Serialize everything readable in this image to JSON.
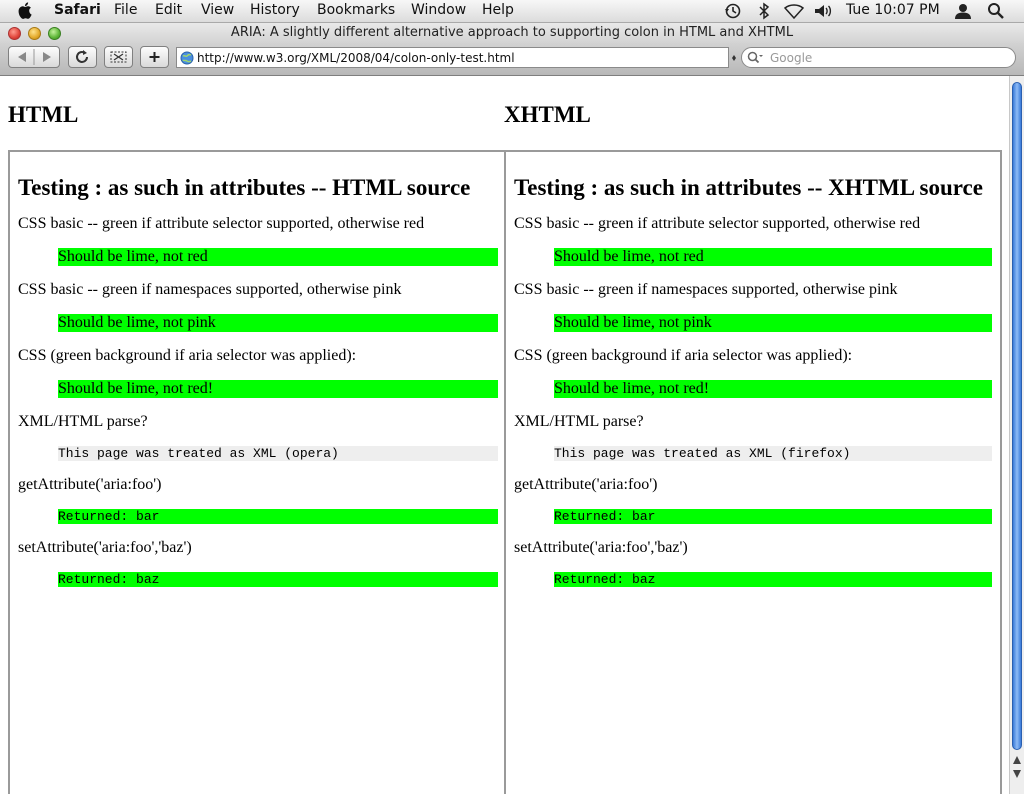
{
  "menubar": {
    "app": "Safari",
    "items": [
      "File",
      "Edit",
      "View",
      "History",
      "Bookmarks",
      "Window",
      "Help"
    ],
    "clock": "Tue 10:07 PM"
  },
  "window": {
    "title": "ARIA: A slightly different alternative approach to supporting colon in HTML and XHTML"
  },
  "toolbar": {
    "url": "http://www.w3.org/XML/2008/04/colon-only-test.html",
    "search_placeholder": "Google"
  },
  "page": {
    "left_heading": "HTML",
    "right_heading": "XHTML",
    "left": {
      "title": "Testing : as such in attributes -- HTML source",
      "css_basic_label": "CSS basic -- green if attribute selector supported, otherwise red",
      "css_basic_result": "Should be lime, not red",
      "ns_label": "CSS basic -- green if namespaces supported, otherwise pink",
      "ns_result": "Should be lime, not pink",
      "aria_label": "CSS (green background if aria selector was applied):",
      "aria_result": "Should be lime, not red!",
      "parse_label": "XML/HTML parse?",
      "parse_result": "This page was treated as XML (opera)",
      "get_label": "getAttribute('aria:foo')",
      "get_result": "Returned: bar",
      "set_label": "setAttribute('aria:foo','baz')",
      "set_result": "Returned: baz"
    },
    "right": {
      "title": "Testing : as such in attributes -- XHTML source",
      "css_basic_label": "CSS basic -- green if attribute selector supported, otherwise red",
      "css_basic_result": "Should be lime, not red",
      "ns_label": "CSS basic -- green if namespaces supported, otherwise pink",
      "ns_result": "Should be lime, not pink",
      "aria_label": "CSS (green background if aria selector was applied):",
      "aria_result": "Should be lime, not red!",
      "parse_label": "XML/HTML parse?",
      "parse_result": "This page was treated as XML (firefox)",
      "get_label": "getAttribute('aria:foo')",
      "get_result": "Returned: bar",
      "set_label": "setAttribute('aria:foo','baz')",
      "set_result": "Returned: baz"
    }
  },
  "colors": {
    "lime": "#00ff00",
    "code_bg": "#eeeeee",
    "scroll_thumb": "#5b98e8"
  },
  "icons": [
    "apple-icon",
    "time-machine-icon",
    "bluetooth-icon",
    "wifi-icon",
    "volume-icon",
    "user-icon",
    "spotlight-icon",
    "back-icon",
    "forward-icon",
    "reload-icon",
    "snippet-icon",
    "add-bookmark-icon",
    "globe-icon",
    "search-icon"
  ]
}
